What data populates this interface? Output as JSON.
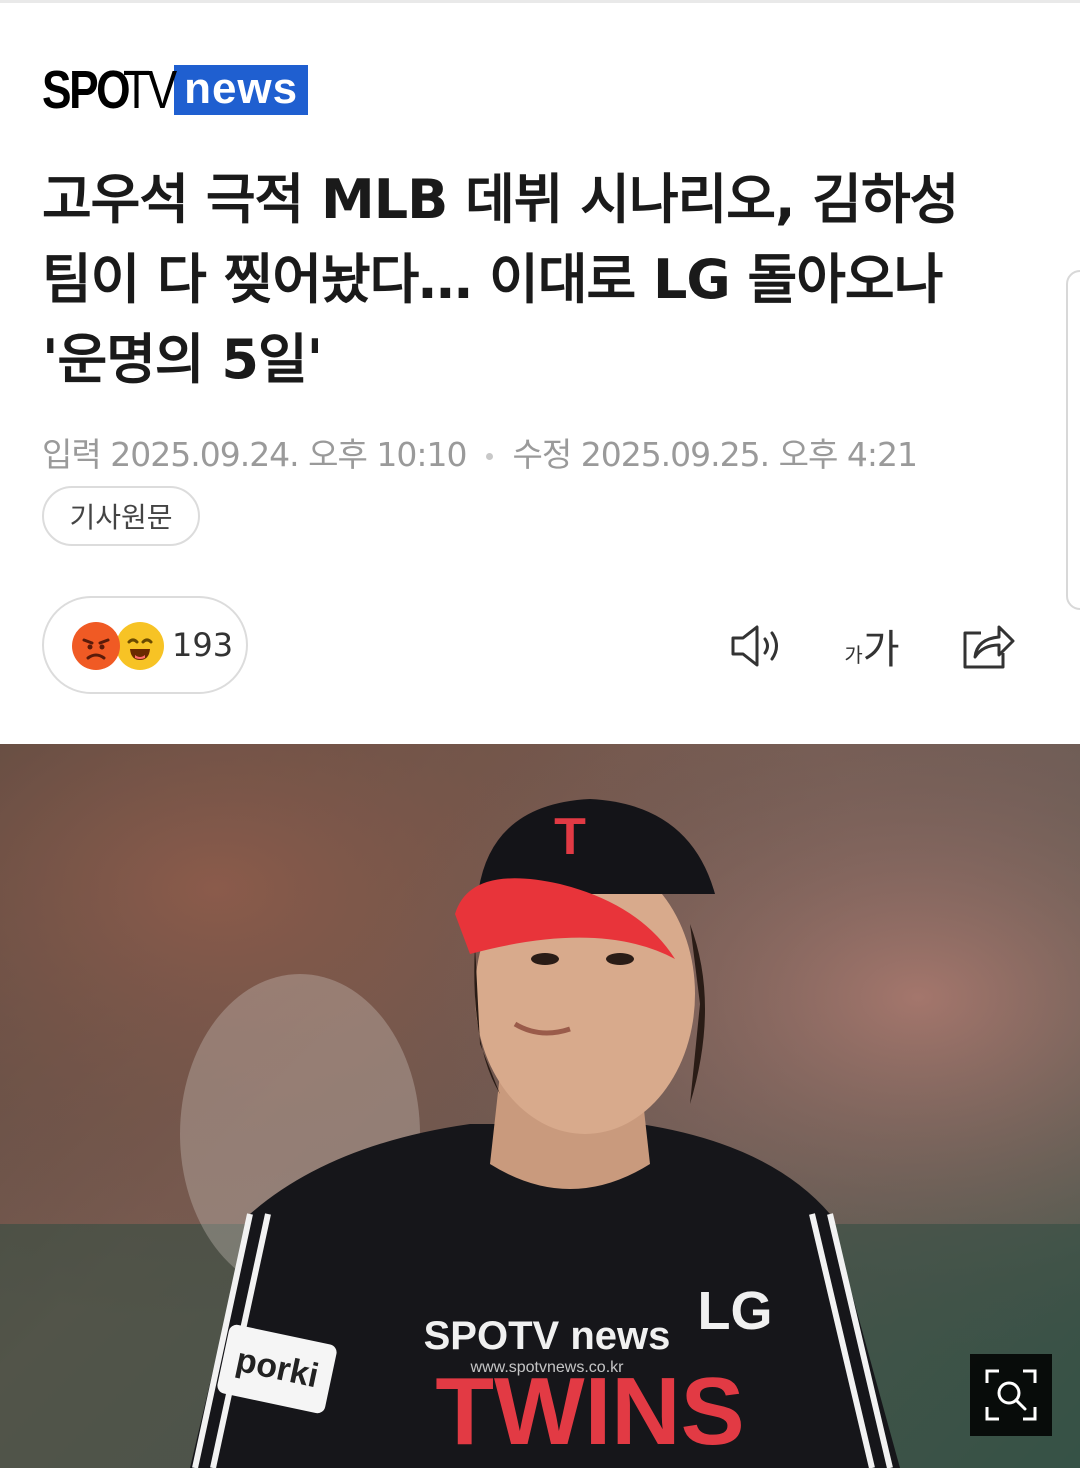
{
  "logo": {
    "part1": "SPO",
    "part2": "TV",
    "part3": "news",
    "accent": "#1f5fd0"
  },
  "article": {
    "title": "고우석 극적 MLB 데뷔 시나리오, 김하성 팀이 다 찢어놨다… 이대로 LG 돌아오나 '운명의 5일'",
    "input_label": "입력",
    "input_date": "2025.09.24. 오후 10:10",
    "edit_label": "수정",
    "edit_date": "2025.09.25. 오후 4:21",
    "original_button": "기사원문"
  },
  "reactions": {
    "count": "193",
    "icons": [
      "angry-emoji-icon",
      "laughing-emoji-icon"
    ]
  },
  "toolbar": {
    "font_small": "가",
    "font_big": "가",
    "icons": [
      "speaker-icon",
      "font-size-icon",
      "share-icon"
    ]
  },
  "photo": {
    "jersey_brand": "TWINS",
    "jersey_team": "LG",
    "cap_letter": "T",
    "sleeve_patch": "porki",
    "watermark_logo": "SPOTV news",
    "watermark_url": "www.spotvnews.co.kr",
    "colors": {
      "jersey": "#16161a",
      "cap_brim": "#e8343a",
      "letters": "#e23a44"
    }
  }
}
